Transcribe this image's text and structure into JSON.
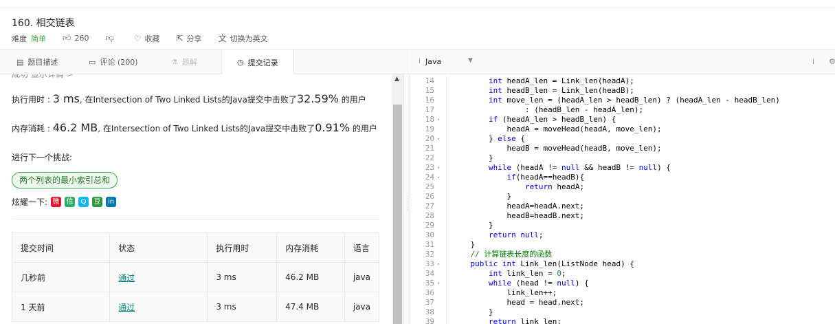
{
  "problem": {
    "title": "160. 相交链表",
    "difficulty_label": "难度",
    "difficulty": "简单",
    "likes": "260",
    "collect": "收藏",
    "share": "分享",
    "switch_lang": "切换为英文"
  },
  "tabs": [
    {
      "label": "题目描述",
      "icon": "doc-icon"
    },
    {
      "label": "评论 (200)",
      "icon": "comment-icon"
    },
    {
      "label": "题解",
      "icon": "flask-icon"
    },
    {
      "label": "提交记录",
      "icon": "clock-icon"
    }
  ],
  "editor": {
    "language": "Java"
  },
  "submission": {
    "cut_text": "成功   显示详情 >",
    "runtime_label": "执行用时 : ",
    "runtime_value": "3 ms",
    "runtime_mid": ", 在Intersection of Two Linked Lists的Java提交中击败了",
    "runtime_pct": "32.59%",
    "runtime_tail": " 的用户",
    "memory_label": "内存消耗 : ",
    "memory_value": "46.2 MB",
    "memory_mid": ", 在Intersection of Two Linked Lists的Java提交中击败了",
    "memory_pct": "0.91%",
    "memory_tail": " 的用户",
    "next_challenge": "进行下一个挑战:",
    "challenge_tag": "两个列表的最小索引总和",
    "share_label": "炫耀一下:"
  },
  "share_icons": [
    {
      "name": "weibo-icon",
      "glyph": "微",
      "color": "#e6162d"
    },
    {
      "name": "wechat-icon",
      "glyph": "信",
      "color": "#2aae67"
    },
    {
      "name": "qq-icon",
      "glyph": "Q",
      "color": "#12b7f5"
    },
    {
      "name": "douban-icon",
      "glyph": "豆",
      "color": "#2e963d"
    },
    {
      "name": "linkedin-icon",
      "glyph": "in",
      "color": "#0077b5"
    }
  ],
  "table": {
    "headers": [
      "提交时间",
      "状态",
      "执行用时",
      "内存消耗",
      "语言"
    ],
    "rows": [
      [
        "几秒前",
        "通过",
        "3 ms",
        "46.2 MB",
        "java"
      ],
      [
        "1 天前",
        "通过",
        "3 ms",
        "47.4 MB",
        "java"
      ]
    ]
  },
  "code": {
    "line_numbers": [
      "14",
      "15",
      "16",
      "17",
      "18",
      "19",
      "20",
      "21",
      "22",
      "23",
      "24",
      "25",
      "26",
      "27",
      "28",
      "29",
      "30",
      "31",
      "32",
      "33",
      "34",
      "35",
      "36",
      "37",
      "38",
      "39"
    ],
    "lines": [
      "        int headA_len = Link_len(headA);",
      "        int headB_len = Link_len(headB);",
      "        int move_len = (headA_len > headB_len) ? (headA_len - headB_len)",
      "                : (headB_len - headA_len);",
      "        if (headA_len > headB_len) {",
      "            headA = moveHead(headA, move_len);",
      "        } else {",
      "            headB = moveHead(headB, move_len);",
      "        }",
      "        while (headA != null && headB != null) {",
      "            if(headA==headB){",
      "                return headA;",
      "            }",
      "            headA=headA.next;",
      "            headB=headB.next;",
      "        }",
      "        return null;",
      "    }",
      "    // 计算链表长度的函数",
      "    public int Link_len(ListNode head) {",
      "        int link_len = 0;",
      "        while (head != null) {",
      "            link_len++;",
      "            head = head.next;",
      "        }",
      "        return link_len;"
    ],
    "folds": [
      "",
      "",
      "",
      "",
      "▾",
      "",
      "▾",
      "",
      "",
      "▾",
      "▾",
      "",
      "",
      "",
      "",
      "",
      "",
      "",
      "",
      "▾",
      "",
      "▾",
      "",
      "",
      "",
      ""
    ]
  }
}
